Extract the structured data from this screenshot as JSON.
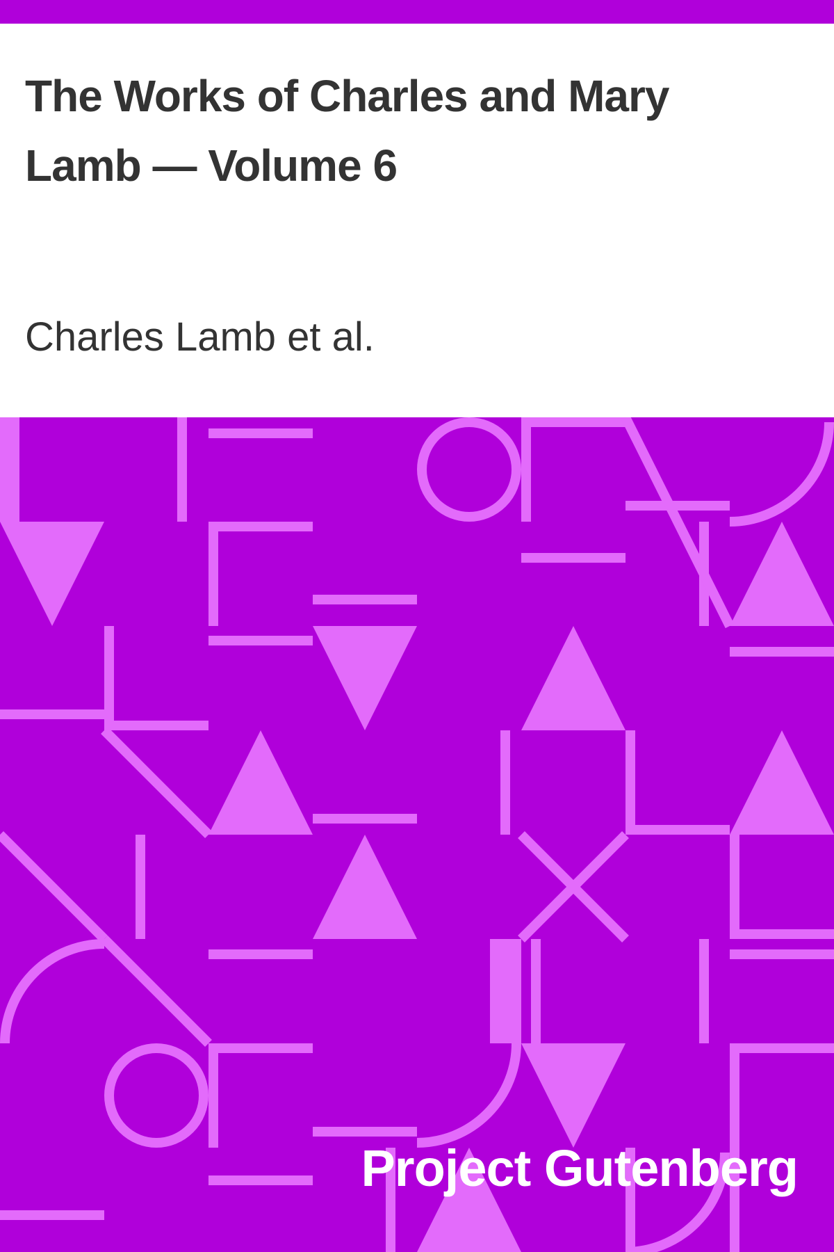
{
  "cover": {
    "title": "The Works of Charles and Mary Lamb — Volume 6",
    "author": "Charles Lamb et al.",
    "publisher": "Project Gutenberg"
  },
  "colors": {
    "accent": "#b000da",
    "pattern_shape": "#e36bfb",
    "text": "#333333",
    "background": "#ffffff"
  }
}
